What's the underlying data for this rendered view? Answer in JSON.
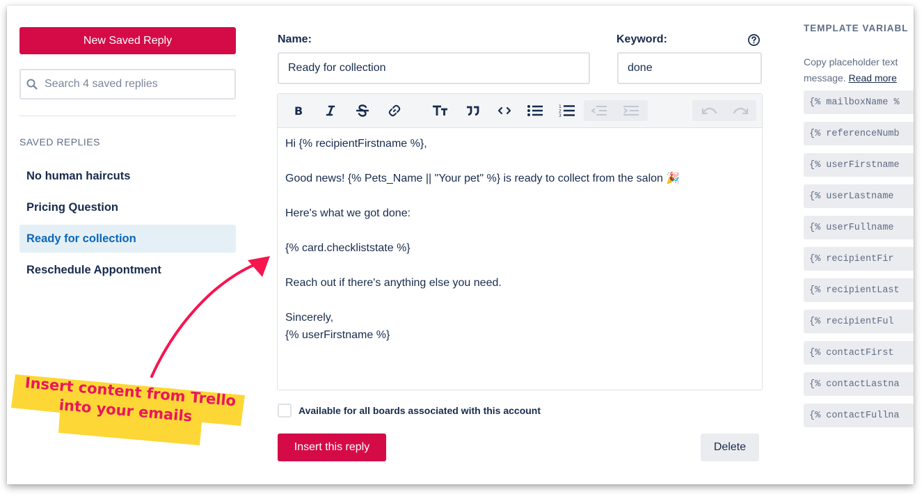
{
  "sidebar": {
    "new_button_label": "New Saved Reply",
    "search_placeholder": "Search 4 saved replies",
    "section_title": "SAVED REPLIES",
    "items": [
      {
        "label": "No human haircuts",
        "active": false
      },
      {
        "label": "Pricing Question",
        "active": false
      },
      {
        "label": "Ready for collection",
        "active": true
      },
      {
        "label": "Reschedule Appontment",
        "active": false
      }
    ]
  },
  "form": {
    "name_label": "Name:",
    "name_value": "Ready for collection",
    "keyword_label": "Keyword:",
    "keyword_value": "done",
    "help_icon": "question-circle-icon",
    "toolbar": [
      "bold-icon",
      "italic-icon",
      "strikethrough-icon",
      "link-icon",
      "text-size-icon",
      "quote-icon",
      "code-icon",
      "bullet-list-icon",
      "numbered-list-icon",
      "outdent-icon",
      "indent-icon",
      "undo-icon",
      "redo-icon"
    ],
    "body": {
      "line1": "Hi {% recipientFirstname %},",
      "line2": "Good news! {% Pets_Name || \"Your pet\" %} is ready to collect from the salon",
      "line2_emoji": "🎉",
      "line3": "Here's what we got done:",
      "line4": "{% card.checkliststate %}",
      "line5": "Reach out if there's anything else you need.",
      "line6": "Sincerely,",
      "line7": "{% userFirstname %}"
    },
    "checkbox_label": "Available for all boards associated with this account",
    "insert_label": "Insert this reply",
    "delete_label": "Delete"
  },
  "template_vars": {
    "title": "TEMPLATE VARIABL",
    "desc_line1": "Copy placeholder text",
    "desc_line2": "message.",
    "read_more": "Read more",
    "items": [
      "{% mailboxName %",
      "{% referenceNumb",
      "{% userFirstname",
      "{% userLastname",
      "{% userFullname",
      "{% recipientFir",
      "{% recipientLast",
      "{% recipientFul",
      "{% contactFirst",
      "{% contactLastna",
      "{% contactFullna"
    ]
  },
  "annotation": {
    "line1": "Insert content from Trello",
    "line2": "into your emails",
    "highlight_color": "#fcd736",
    "text_color": "#e8175d"
  },
  "colors": {
    "primary": "#d40b47",
    "active_bg": "#e4f0f6",
    "active_text": "#0c66b8"
  }
}
